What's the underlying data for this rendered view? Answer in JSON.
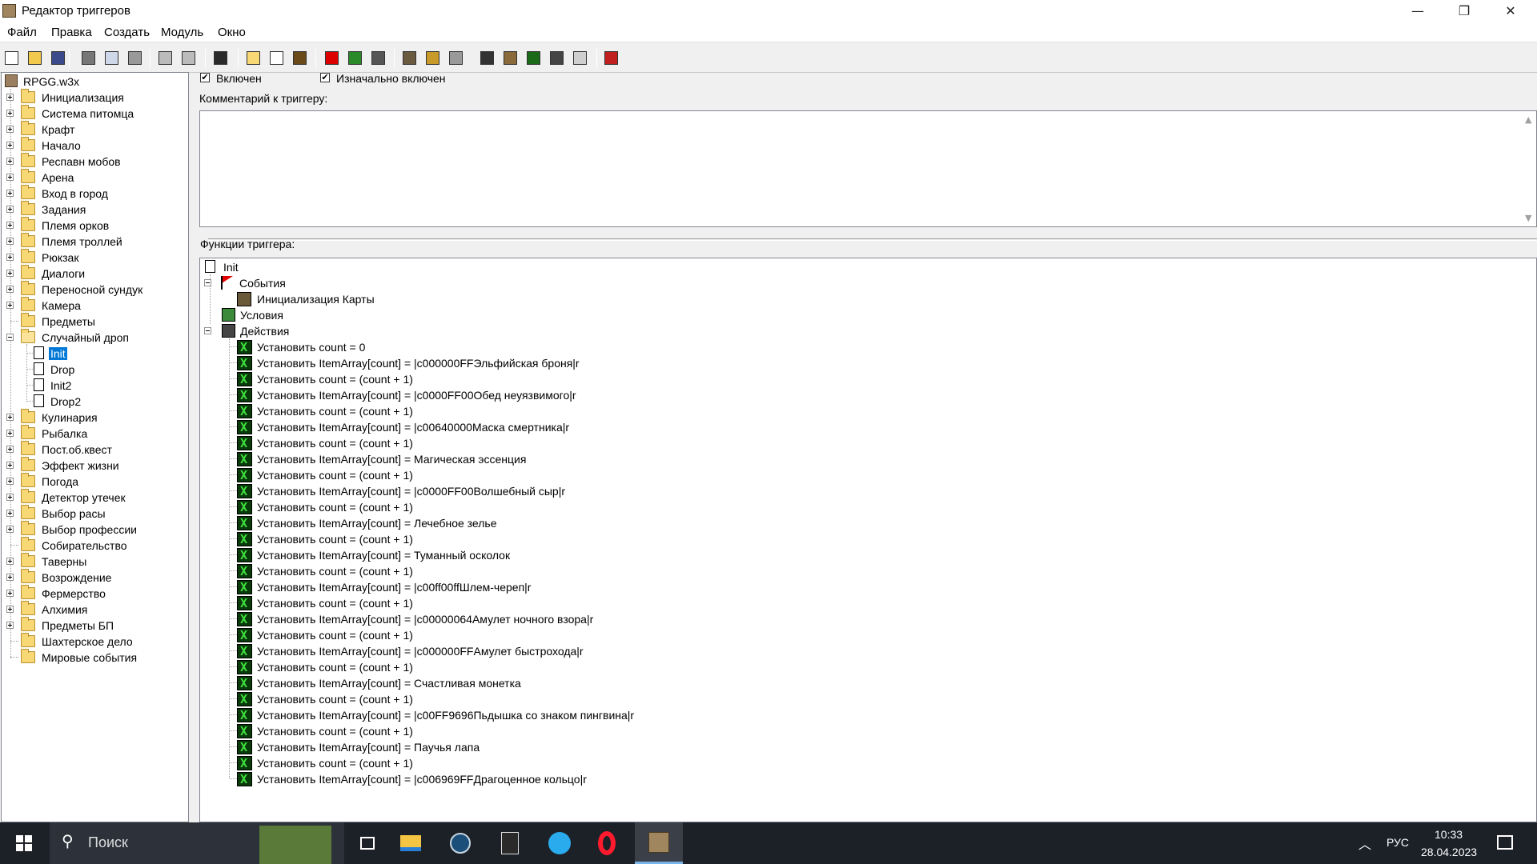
{
  "window": {
    "title": "Редактор триггеров",
    "controls": {
      "minimize": "—",
      "maximize": "❐",
      "close": "✕"
    }
  },
  "menu": [
    "Файл",
    "Правка",
    "Создать",
    "Модуль",
    "Окно"
  ],
  "toolbar": {
    "icons": [
      "new-icon",
      "open-icon",
      "save-icon",
      "cut-icon",
      "copy-icon",
      "paste-icon",
      "undo-icon",
      "redo-icon",
      "delete-icon",
      "new-category-icon",
      "new-trigger-icon",
      "new-comment-icon",
      "new-event-icon",
      "new-condition-icon",
      "new-action-icon",
      "terrain-editor-icon",
      "trigger-editor-icon",
      "sound-editor-icon",
      "object-editor-icon",
      "campaign-editor-icon",
      "ai-editor-icon",
      "object-manager-icon",
      "import-manager-icon",
      "test-map-icon"
    ]
  },
  "tree": {
    "root": "RPGG.w3x",
    "items": [
      {
        "label": "Инициализация",
        "expand": "plus"
      },
      {
        "label": "Система питомца",
        "expand": "plus"
      },
      {
        "label": "Крафт",
        "expand": "plus"
      },
      {
        "label": "Начало",
        "expand": "plus"
      },
      {
        "label": "Респавн мобов",
        "expand": "plus"
      },
      {
        "label": "Арена",
        "expand": "plus"
      },
      {
        "label": "Вход в город",
        "expand": "plus"
      },
      {
        "label": "Задания",
        "expand": "plus"
      },
      {
        "label": "Племя орков",
        "expand": "plus"
      },
      {
        "label": "Племя троллей",
        "expand": "plus"
      },
      {
        "label": "Рюкзак",
        "expand": "plus"
      },
      {
        "label": "Диалоги",
        "expand": "plus"
      },
      {
        "label": "Переносной сундук",
        "expand": "plus"
      },
      {
        "label": "Камера",
        "expand": "plus"
      },
      {
        "label": "Предметы",
        "expand": "none"
      },
      {
        "label": "Случайный дроп",
        "expand": "minus",
        "open": true
      },
      {
        "label": "Init",
        "child": true,
        "selected": true
      },
      {
        "label": "Drop",
        "child": true
      },
      {
        "label": "Init2",
        "child": true
      },
      {
        "label": "Drop2",
        "child": true
      },
      {
        "label": "Кулинария",
        "expand": "plus"
      },
      {
        "label": "Рыбалка",
        "expand": "plus"
      },
      {
        "label": "Пост.об.квест",
        "expand": "plus"
      },
      {
        "label": "Эффект жизни",
        "expand": "plus"
      },
      {
        "label": "Погода",
        "expand": "plus"
      },
      {
        "label": "Детектор утечек",
        "expand": "plus"
      },
      {
        "label": "Выбор расы",
        "expand": "plus"
      },
      {
        "label": "Выбор профессии",
        "expand": "plus"
      },
      {
        "label": "Собирательство",
        "expand": "none"
      },
      {
        "label": "Таверны",
        "expand": "plus"
      },
      {
        "label": "Возрождение",
        "expand": "plus"
      },
      {
        "label": "Фермерство",
        "expand": "plus"
      },
      {
        "label": "Алхимия",
        "expand": "plus"
      },
      {
        "label": "Предметы БП",
        "expand": "plus"
      },
      {
        "label": "Шахтерское дело",
        "expand": "none"
      },
      {
        "label": "Мировые события",
        "expand": "none"
      }
    ]
  },
  "trigger": {
    "enabled_label": "Включен",
    "initially_on_label": "Изначально включен",
    "comment_label": "Комментарий к триггеру:",
    "functions_label": "Функции триггера:",
    "name": "Init",
    "events_label": "События",
    "event": "Инициализация Карты",
    "conditions_label": "Условия",
    "actions_label": "Действия",
    "actions": [
      "Установить count = 0",
      "Установить ItemArray[count] = |c000000FFЭльфийская броня|r",
      "Установить count = (count + 1)",
      "Установить ItemArray[count] = |c0000FF00Обед неуязвимого|r",
      "Установить count = (count + 1)",
      "Установить ItemArray[count] = |c00640000Маска смертника|r",
      "Установить count = (count + 1)",
      "Установить ItemArray[count] = Магическая эссенция",
      "Установить count = (count + 1)",
      "Установить ItemArray[count] = |c0000FF00Волшебный сыр|r",
      "Установить count = (count + 1)",
      "Установить ItemArray[count] = Лечебное зелье",
      "Установить count = (count + 1)",
      "Установить ItemArray[count] = Туманный осколок",
      "Установить count = (count + 1)",
      "Установить ItemArray[count] = |c00ff00ffШлем-череп|r",
      "Установить count = (count + 1)",
      "Установить ItemArray[count] = |c00000064Амулет ночного взора|r",
      "Установить count = (count + 1)",
      "Установить ItemArray[count] = |c000000FFАмулет быстрохода|r",
      "Установить count = (count + 1)",
      "Установить ItemArray[count] = Счастливая монетка",
      "Установить count = (count + 1)",
      "Установить ItemArray[count] = |c00FF9696Пьдышка со знаком пингвина|r",
      "Установить count = (count + 1)",
      "Установить ItemArray[count] = Паучья лапа",
      "Установить count = (count + 1)",
      "Установить ItemArray[count] = |c006969FFДрагоценное кольцо|r"
    ]
  },
  "taskbar": {
    "search_placeholder": "Поиск",
    "lang": "РУС",
    "time": "10:33",
    "date": "28.04.2023"
  }
}
